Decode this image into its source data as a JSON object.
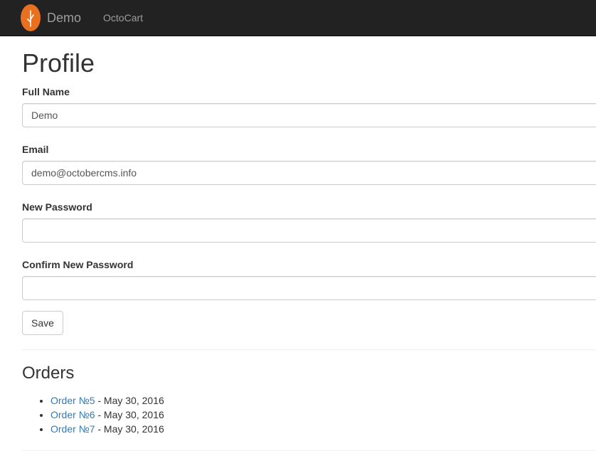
{
  "navbar": {
    "brand": "Demo",
    "logo_icon": "leaf-logo-icon",
    "logo_color": "#e8701f",
    "links": [
      "OctoCart"
    ]
  },
  "profile": {
    "title": "Profile",
    "fields": [
      {
        "label": "Full Name",
        "value": "Demo"
      },
      {
        "label": "Email",
        "value": "demo@octobercms.info"
      },
      {
        "label": "New Password",
        "value": ""
      },
      {
        "label": "Confirm New Password",
        "value": ""
      }
    ],
    "save_label": "Save"
  },
  "orders": {
    "title": "Orders",
    "items": [
      {
        "link": "Order №5",
        "date": " - May 30, 2016"
      },
      {
        "link": "Order №6",
        "date": " - May 30, 2016"
      },
      {
        "link": "Order №7",
        "date": " - May 30, 2016"
      }
    ]
  },
  "colors": {
    "navbar_bg": "#222222",
    "link": "#337ab7"
  }
}
